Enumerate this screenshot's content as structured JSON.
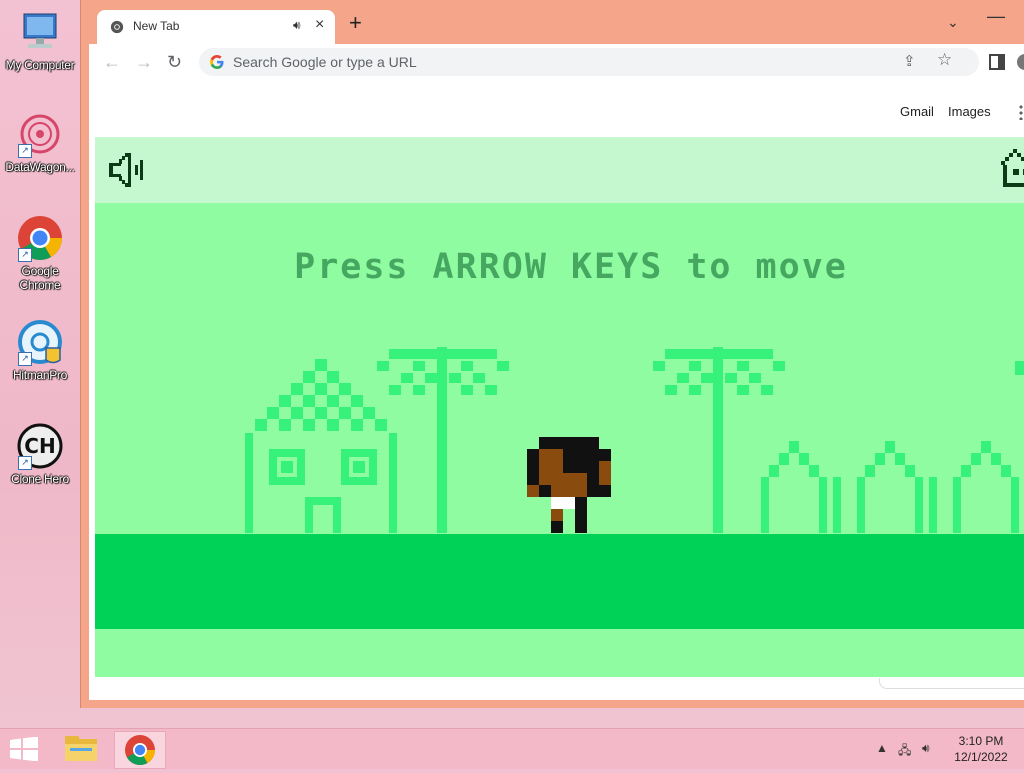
{
  "desktop": {
    "icons": [
      {
        "label": "My Computer"
      },
      {
        "label": "DataWagon..."
      },
      {
        "label": "Google Chrome"
      },
      {
        "label": "HitmanPro"
      },
      {
        "label": "Clone Hero"
      }
    ]
  },
  "browser": {
    "tab": {
      "title": "New Tab"
    },
    "omnibox": {
      "placeholder": "Search Google or type a URL"
    },
    "top_links": {
      "gmail": "Gmail",
      "images": "Images"
    }
  },
  "game": {
    "prompt": "Press ARROW KEYS to move",
    "colors": {
      "sky": "#8ffca2",
      "header": "#c6f8cf",
      "ground": "#00d157",
      "scenery": "#37f27a"
    }
  },
  "taskbar": {
    "time": "3:10 PM",
    "date": "12/1/2022"
  },
  "icons": {
    "speaker": "speaker-icon",
    "home": "home-icon",
    "start": "windows-logo-icon"
  }
}
